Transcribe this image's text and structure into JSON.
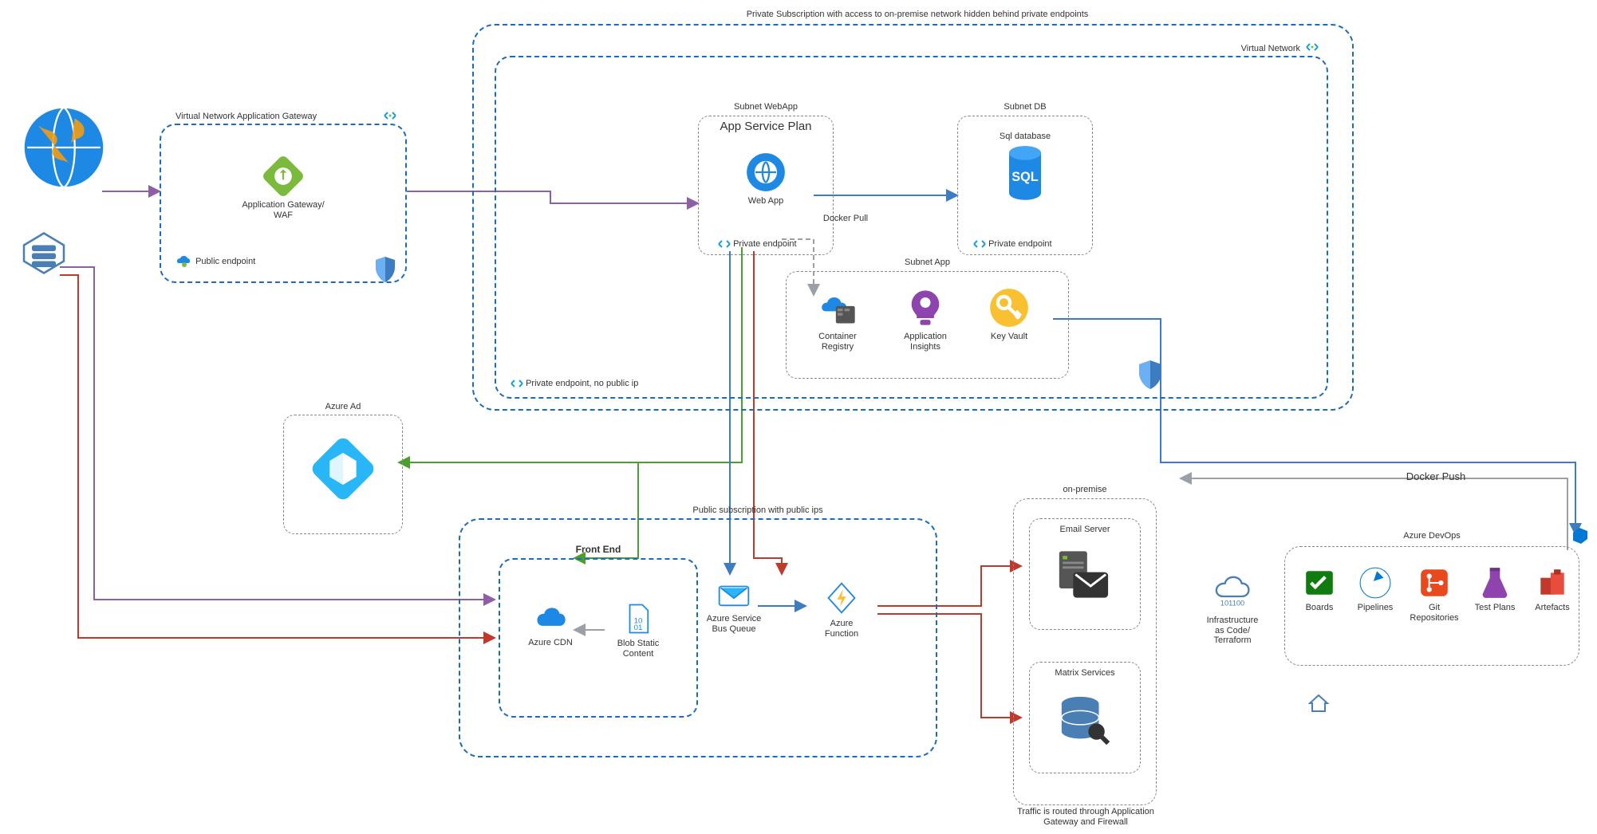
{
  "titles": {
    "privateSub": "Private Subscription with access to on-premise network hidden behind private endpoints",
    "vnet": "Virtual Network",
    "vnetAppGw": "Virtual Network Application Gateway",
    "subnetWebApp": "Subnet WebApp",
    "appServicePlan": "App Service Plan",
    "subnetDb": "Subnet DB",
    "subnetApp": "Subnet App",
    "azureAd": "Azure Ad",
    "publicSub": "Public subscription with public ips",
    "frontEnd": "Front End",
    "onPremise": "on-premise",
    "azureDevOps": "Azure DevOps"
  },
  "annotations": {
    "publicEndpoint": "Public endpoint",
    "privateEndpointNoIp": "Private endpoint, no public ip",
    "dockerPull": "Docker Pull",
    "dockerPush": "Docker Push",
    "trafficNote": "Traffic is routed through Application Gateway and Firewall"
  },
  "nodes": {
    "appGateway": "Application Gateway/\nWAF",
    "webApp": "Web App",
    "privateEndpoint": "Private endpoint",
    "sqlDb": "Sql database",
    "containerRegistry": "Container\nRegistry",
    "appInsights": "Application\nInsights",
    "keyVault": "Key Vault",
    "azureCdn": "Azure CDN",
    "blobStatic": "Blob Static\nContent",
    "serviceBus": "Azure Service\nBus Queue",
    "azureFunction": "Azure\nFunction",
    "emailServer": "Email Server",
    "matrixServices": "Matrix Services",
    "iac": "Infrastructure\nas Code/\nTerraform",
    "boards": "Boards",
    "pipelines": "Pipelines",
    "gitRepos": "Git\nRepositories",
    "testPlans": "Test Plans",
    "artefacts": "Artefacts"
  },
  "colors": {
    "purple": "#8e5ea6",
    "blue": "#3e7cc2",
    "green": "#4aa02c",
    "red": "#c0392b",
    "grey": "#9aa0a6",
    "dashBlue": "#1e6bb8"
  }
}
